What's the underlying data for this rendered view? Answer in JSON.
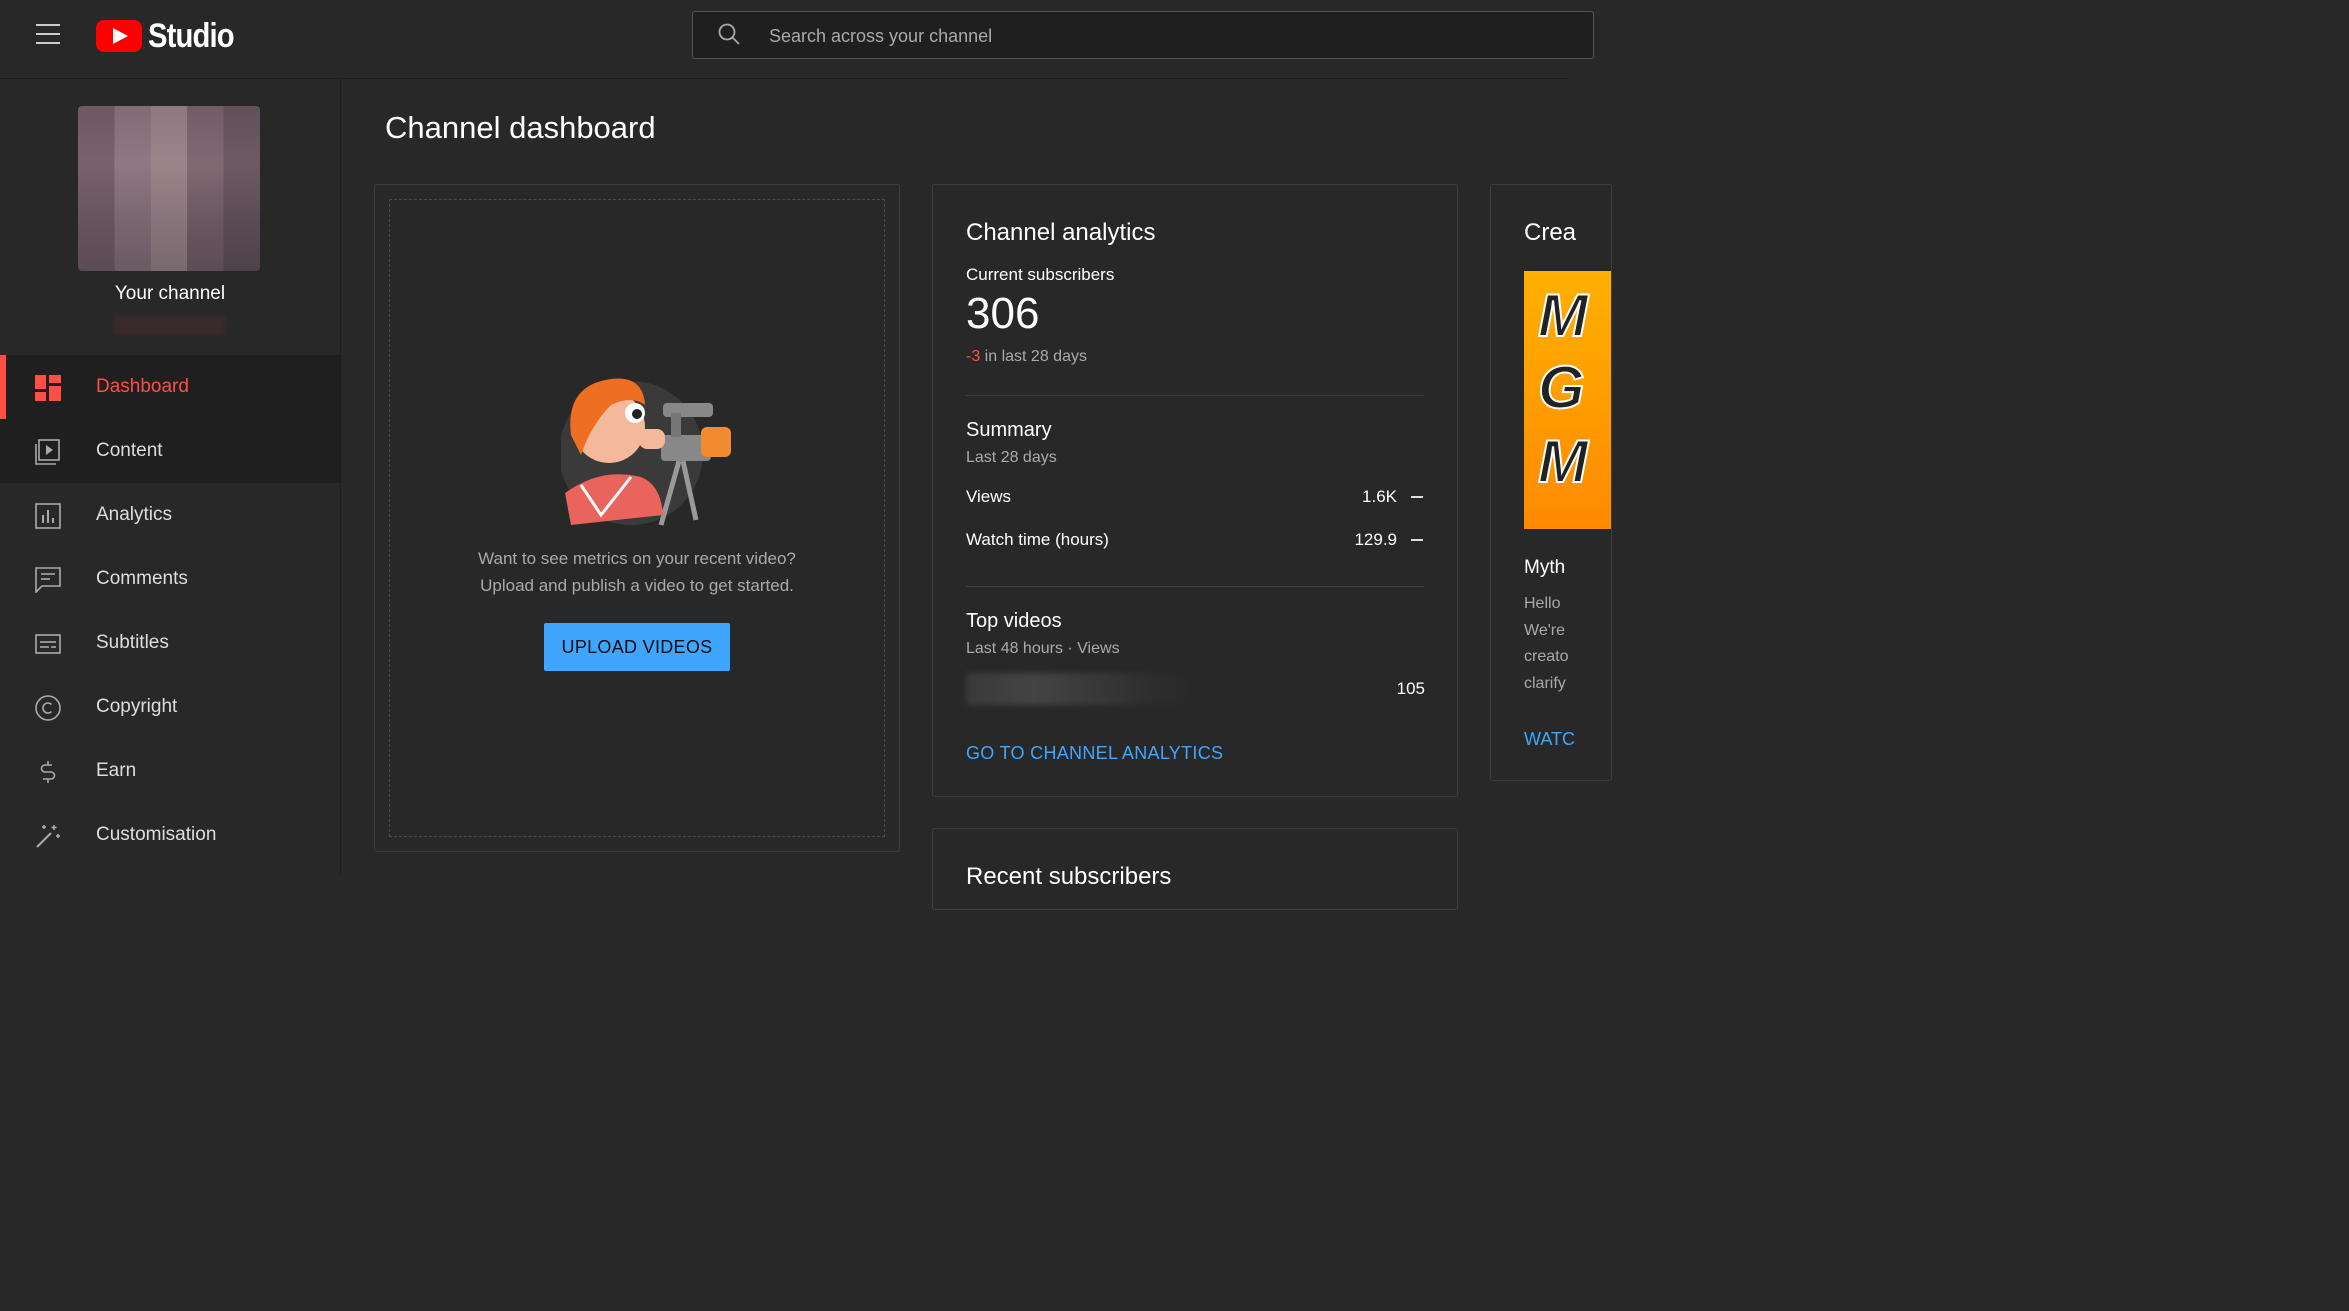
{
  "header": {
    "logo_text": "Studio",
    "search_placeholder": "Search across your channel"
  },
  "sidebar": {
    "channel_label": "Your channel",
    "items": [
      {
        "label": "Dashboard",
        "icon": "dashboard-icon",
        "active": true
      },
      {
        "label": "Content",
        "icon": "content-icon"
      },
      {
        "label": "Analytics",
        "icon": "analytics-icon"
      },
      {
        "label": "Comments",
        "icon": "comments-icon"
      },
      {
        "label": "Subtitles",
        "icon": "subtitles-icon"
      },
      {
        "label": "Copyright",
        "icon": "copyright-icon"
      },
      {
        "label": "Earn",
        "icon": "earn-icon"
      },
      {
        "label": "Customisation",
        "icon": "customisation-icon"
      }
    ]
  },
  "main": {
    "title": "Channel dashboard",
    "upload_card": {
      "line1": "Want to see metrics on your recent video?",
      "line2": "Upload and publish a video to get started.",
      "button": "UPLOAD VIDEOS"
    },
    "analytics": {
      "title": "Channel analytics",
      "subscribers_label": "Current subscribers",
      "subscribers_value": "306",
      "change_value": "-3",
      "change_suffix": " in last 28 days",
      "summary_title": "Summary",
      "summary_period": "Last 28 days",
      "views_label": "Views",
      "views_value": "1.6K",
      "watch_label": "Watch time (hours)",
      "watch_value": "129.9",
      "top_title": "Top videos",
      "top_period": "Last 48 hours · Views",
      "top_video_views": "105",
      "link": "GO TO CHANNEL ANALYTICS"
    },
    "creator_card": {
      "title_partial": "Crea",
      "thumb_letters": [
        "M",
        "G",
        "M"
      ],
      "subtitle_partial": "Myth",
      "body_partial": "Hello\nWe're\ncreato\nclarify",
      "link_partial": "WATC"
    },
    "recent_subscribers": {
      "title": "Recent subscribers"
    }
  },
  "colors": {
    "accent_red": "#ff4e45",
    "link_blue": "#3ea6ff",
    "background": "#282828"
  }
}
